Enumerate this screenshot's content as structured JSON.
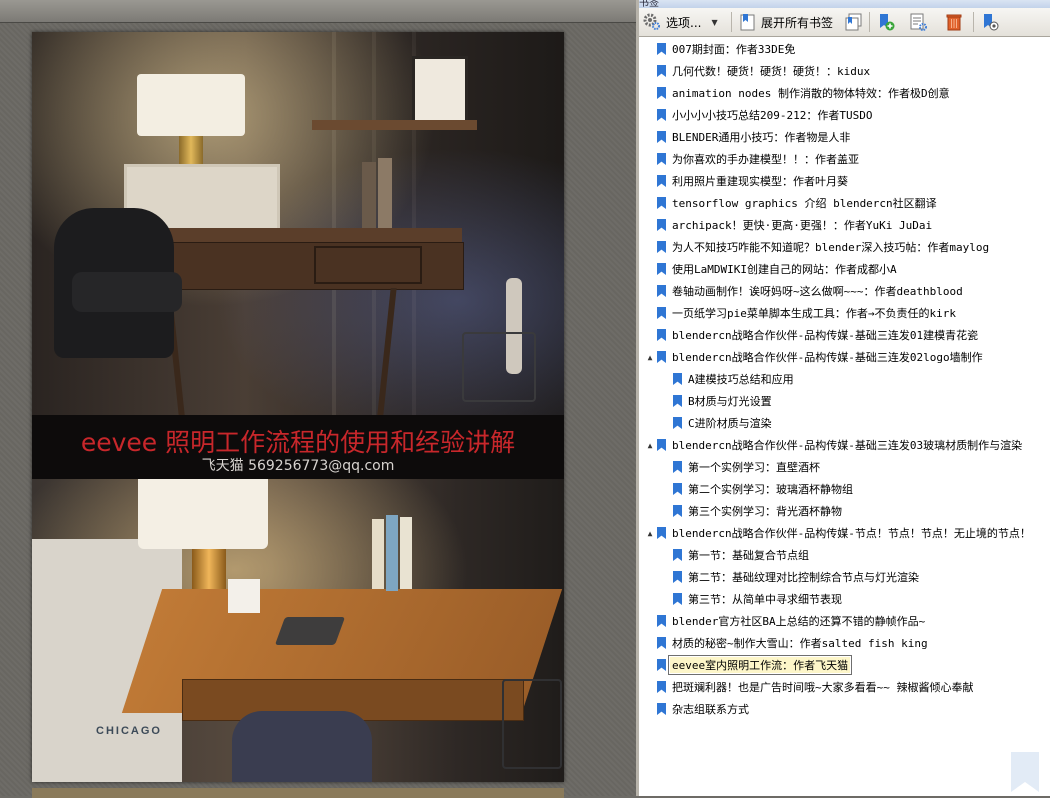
{
  "document": {
    "banner_title": "eevee 照明工作流程的使用和经验讲解",
    "banner_subtitle": "飞天猫 569256773@qq.com",
    "photo_caption": "CHICAGO"
  },
  "panel": {
    "title": "书签",
    "toolbar": {
      "options_label": "选项...",
      "expand_all_label": "展开所有书签"
    },
    "bookmarks": [
      {
        "label": "007期封面：作者33DE免",
        "level": 0,
        "toggle": ""
      },
      {
        "label": "几何代数！硬货！硬货！硬货！：kidux",
        "level": 0,
        "toggle": ""
      },
      {
        "label": "animation nodes 制作消散的物体特效：作者极D创意",
        "level": 0,
        "toggle": ""
      },
      {
        "label": "小小小小技巧总结209-212：作者TUSDO",
        "level": 0,
        "toggle": ""
      },
      {
        "label": "BLENDER通用小技巧：作者物是人非",
        "level": 0,
        "toggle": ""
      },
      {
        "label": "为你喜欢的手办建模型！！：作者盖亚",
        "level": 0,
        "toggle": ""
      },
      {
        "label": "利用照片重建现实模型：作者叶月葵",
        "level": 0,
        "toggle": ""
      },
      {
        "label": "tensorflow graphics 介绍 blendercn社区翻译",
        "level": 0,
        "toggle": ""
      },
      {
        "label": "archipack！更快·更高·更强！：作者YuKi JuDai",
        "level": 0,
        "toggle": ""
      },
      {
        "label": "为人不知技巧咋能不知道呢？blender深入技巧帖：作者maylog",
        "level": 0,
        "toggle": ""
      },
      {
        "label": "使用LaMDWIKI创建自己的网站：作者成都小A",
        "level": 0,
        "toggle": ""
      },
      {
        "label": "卷轴动画制作！诶呀妈呀~这么做啊~~~：作者deathblood",
        "level": 0,
        "toggle": ""
      },
      {
        "label": "一页纸学习pie菜单脚本生成工具：作者→不负责任的kirk",
        "level": 0,
        "toggle": ""
      },
      {
        "label": "blendercn战略合作伙伴-品构传媒-基础三连发01建模青花瓷",
        "level": 0,
        "toggle": ""
      },
      {
        "label": "blendercn战略合作伙伴-品构传媒-基础三连发02logo墙制作",
        "level": 0,
        "toggle": "▲"
      },
      {
        "label": "A建模技巧总结和应用",
        "level": 1,
        "toggle": ""
      },
      {
        "label": "B材质与灯光设置",
        "level": 1,
        "toggle": ""
      },
      {
        "label": "C进阶材质与渲染",
        "level": 1,
        "toggle": ""
      },
      {
        "label": "blendercn战略合作伙伴-品构传媒-基础三连发03玻璃材质制作与渲染",
        "level": 0,
        "toggle": "▲"
      },
      {
        "label": "第一个实例学习：直壁酒杯",
        "level": 1,
        "toggle": ""
      },
      {
        "label": "第二个实例学习：玻璃酒杯静物组",
        "level": 1,
        "toggle": ""
      },
      {
        "label": "第三个实例学习：背光酒杯静物",
        "level": 1,
        "toggle": ""
      },
      {
        "label": "blendercn战略合作伙伴-品构传媒-节点！节点！节点！无止境的节点！",
        "level": 0,
        "toggle": "▲"
      },
      {
        "label": "第一节：基础复合节点组",
        "level": 1,
        "toggle": ""
      },
      {
        "label": "第二节：基础纹理对比控制综合节点与灯光渲染",
        "level": 1,
        "toggle": ""
      },
      {
        "label": "第三节：从简单中寻求细节表现",
        "level": 1,
        "toggle": ""
      },
      {
        "label": "blender官方社区BA上总结的还算不错的静帧作品~",
        "level": 0,
        "toggle": ""
      },
      {
        "label": "材质的秘密~制作大雪山：作者salted fish king",
        "level": 0,
        "toggle": ""
      },
      {
        "label": "eevee室内照明工作流：作者飞天猫",
        "level": 0,
        "toggle": "",
        "selected": true
      },
      {
        "label": "把斑斓利器！也是广告时间哦~大家多看看~~ 辣椒酱倾心奉献",
        "level": 0,
        "toggle": ""
      },
      {
        "label": "杂志组联系方式",
        "level": 0,
        "toggle": ""
      }
    ]
  },
  "colors": {
    "bookmark_blue": "#2f76d4",
    "banner_red": "#c8272b",
    "selection_bg": "#fdf6c9"
  }
}
